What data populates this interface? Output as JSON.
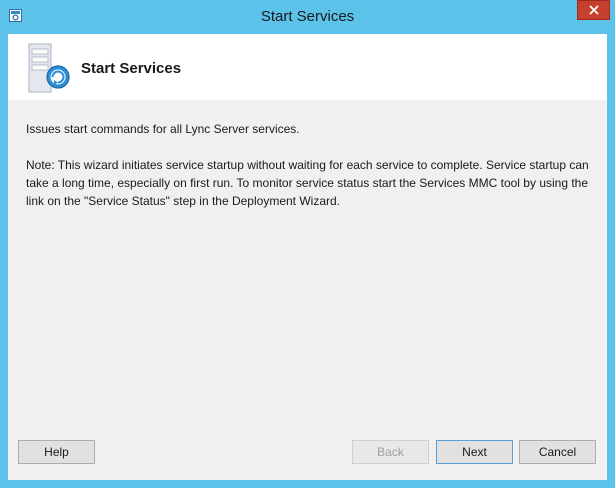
{
  "window": {
    "title": "Start Services"
  },
  "header": {
    "title": "Start Services"
  },
  "content": {
    "description": "Issues start commands for all Lync Server services.",
    "note": "Note: This wizard initiates service startup without waiting for each service to complete. Service startup can take a long time, especially on first run. To monitor service status start the Services MMC tool by using the link on the \"Service Status\" step in the Deployment Wizard."
  },
  "buttons": {
    "help": "Help",
    "back": "Back",
    "next": "Next",
    "cancel": "Cancel"
  },
  "colors": {
    "frame": "#5cc2ea",
    "close": "#c7402f",
    "client": "#f0f0f0",
    "header": "#ffffff"
  },
  "icons": {
    "app": "wizard-app-icon",
    "header": "server-start-icon",
    "close": "close-icon"
  }
}
